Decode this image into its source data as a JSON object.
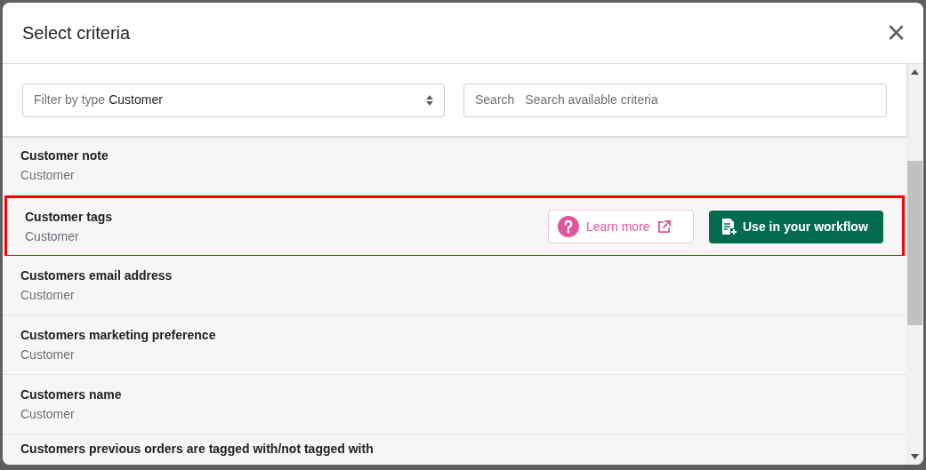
{
  "dialog": {
    "title": "Select criteria",
    "close": "×"
  },
  "filter": {
    "label": "Filter by type",
    "value": "Customer"
  },
  "search": {
    "label": "Search",
    "placeholder": "Search available criteria"
  },
  "criteria": [
    {
      "name": "Customer note",
      "type": "Customer",
      "highlighted": false
    },
    {
      "name": "Customer tags",
      "type": "Customer",
      "highlighted": true,
      "actions": {
        "learn_more": "Learn more",
        "use": "Use in your workflow"
      }
    },
    {
      "name": "Customers email address",
      "type": "Customer",
      "highlighted": false
    },
    {
      "name": "Customers marketing preference",
      "type": "Customer",
      "highlighted": false
    },
    {
      "name": "Customers name",
      "type": "Customer",
      "highlighted": false
    },
    {
      "name": "Customers previous orders are tagged with/not tagged with",
      "highlighted": false
    }
  ]
}
